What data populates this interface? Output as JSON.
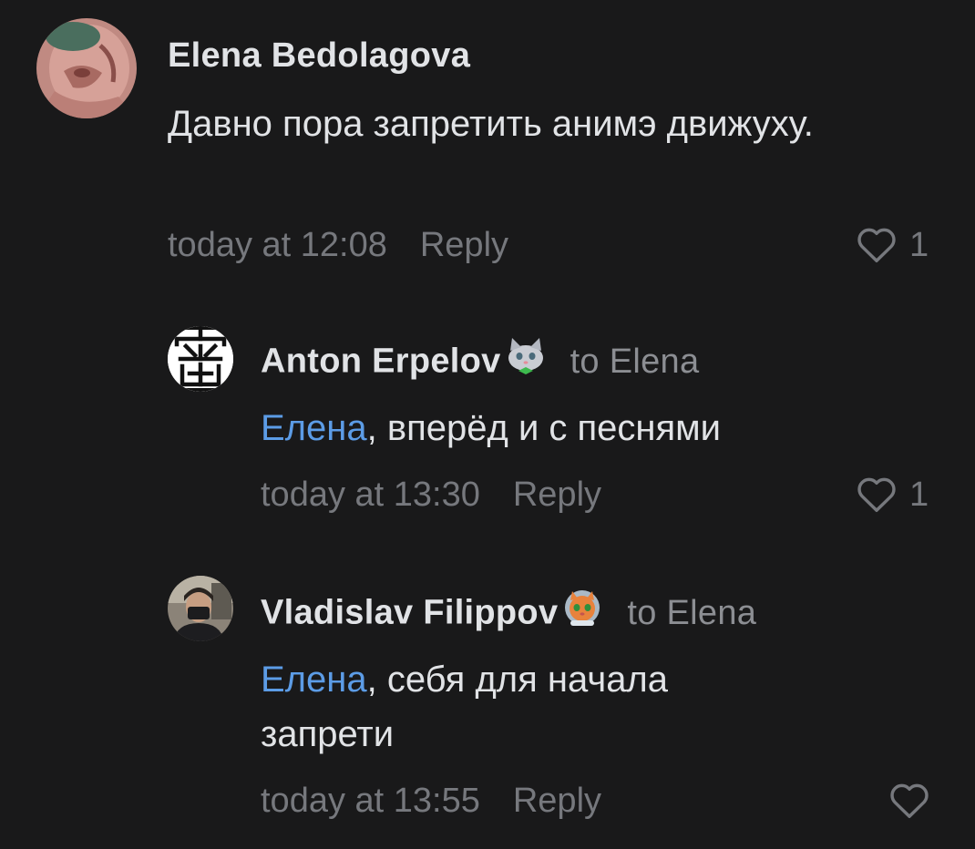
{
  "comments": [
    {
      "author": "Elena Bedolagova",
      "reply_to": "",
      "mention": "",
      "text": "Давно пора запретить анимэ движуху.",
      "time": "today at 12:08",
      "reply_label": "Reply",
      "likes": "1",
      "avatar_icon": "avatar-photo-icon"
    },
    {
      "author": "Anton Erpelov",
      "reply_to": "to Elena",
      "mention": "Елена",
      "text": ", вперёд и с песнями",
      "time": "today at 13:30",
      "reply_label": "Reply",
      "likes": "1",
      "avatar_icon": "kanji-avatar-icon",
      "badge_icon": "cat-emoji-icon"
    },
    {
      "author": "Vladislav Filippov",
      "reply_to": "to Elena",
      "mention": "Елена",
      "text": ", себя для начала запрети",
      "time": "today at 13:55",
      "reply_label": "Reply",
      "likes": "",
      "avatar_icon": "avatar-photo-icon",
      "badge_icon": "cat-astronaut-emoji-icon"
    }
  ],
  "colors": {
    "background": "#19191a",
    "text": "#e1e3e6",
    "muted": "#76787d",
    "mention": "#5c9ce6"
  }
}
